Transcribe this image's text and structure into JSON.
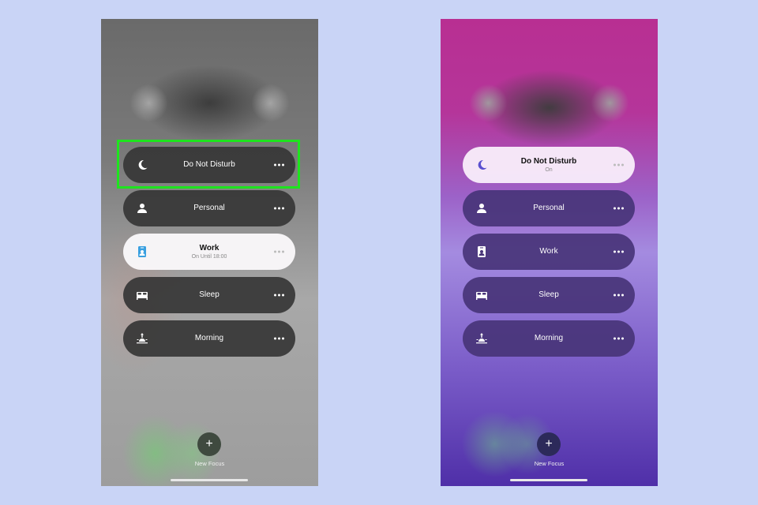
{
  "phones": [
    {
      "theme": "gray",
      "focus_modes": [
        {
          "label": "Do Not Disturb",
          "subtitle": "",
          "icon": "moon-icon",
          "active": false
        },
        {
          "label": "Personal",
          "subtitle": "",
          "icon": "person-icon",
          "active": false
        },
        {
          "label": "Work",
          "subtitle": "On Until 18:00",
          "icon": "id-badge-icon",
          "active": true
        },
        {
          "label": "Sleep",
          "subtitle": "",
          "icon": "bed-icon",
          "active": false
        },
        {
          "label": "Morning",
          "subtitle": "",
          "icon": "sunrise-icon",
          "active": false
        }
      ],
      "highlighted": "Do Not Disturb",
      "new_focus_label": "New Focus",
      "new_focus_icon": "+"
    },
    {
      "theme": "purple",
      "focus_modes": [
        {
          "label": "Do Not Disturb",
          "subtitle": "On",
          "icon": "moon-icon",
          "active": true
        },
        {
          "label": "Personal",
          "subtitle": "",
          "icon": "person-icon",
          "active": false
        },
        {
          "label": "Work",
          "subtitle": "",
          "icon": "id-badge-icon",
          "active": false
        },
        {
          "label": "Sleep",
          "subtitle": "",
          "icon": "bed-icon",
          "active": false
        },
        {
          "label": "Morning",
          "subtitle": "",
          "icon": "sunrise-icon",
          "active": false
        }
      ],
      "new_focus_label": "New Focus",
      "new_focus_icon": "+"
    }
  ],
  "colors": {
    "highlight": "#1ee41e",
    "moon_active": "#5a4fcf",
    "work_active": "#3aa0e0"
  }
}
